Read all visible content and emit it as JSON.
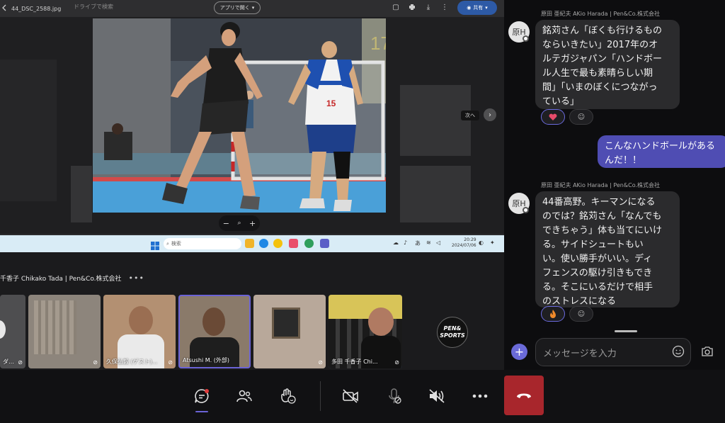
{
  "viewer": {
    "filename": "44_DSC_2588.jpg",
    "search_placeholder": "ドライブで検索",
    "open_with": "アプリで開く",
    "share": "共有",
    "next": "次へ"
  },
  "taskbar": {
    "search": "検索",
    "time": "20:29",
    "date": "2024/07/06",
    "ime": "あ"
  },
  "presenter": {
    "name": "千香子 Chikako Tada | Pen&Co.株式会社",
    "more": "•••"
  },
  "participants": [
    {
      "name": "ダ…",
      "muted": true
    },
    {
      "name": "",
      "muted": true
    },
    {
      "name": "久保弘毅 (ゲスト)...",
      "muted": true
    },
    {
      "name": "Atsushi M. (外部)",
      "muted": false
    },
    {
      "name": "",
      "muted": true
    },
    {
      "name": "多田 千香子 Chi...",
      "muted": true
    }
  ],
  "pen_logo": {
    "line1": "PEN&",
    "line2": "SPORTS"
  },
  "chat": {
    "messages": [
      {
        "sender": "原田 亜紀夫 AKio Harada | Pen&Co.株式会社",
        "avatar": "原H",
        "lines": [
          "銘苅さん「ぼくも行けるもの",
          "ならいきたい」2017年のオ",
          "ルテガジャパン「ハンドボー",
          "ル人生で最も素晴らしい期",
          "間」「いまのぼくにつながっ",
          "ている」"
        ],
        "reaction": "heart"
      },
      {
        "mine": true,
        "lines": [
          "こんなハンドボールがある",
          "んだ！！"
        ]
      },
      {
        "sender": "原田 亜紀夫 AKio Harada | Pen&Co.株式会社",
        "avatar": "原H",
        "lines": [
          "44番高野。キーマンになる",
          "のでは？銘苅さん「なんでも",
          "できちゃう」体も当てにいけ",
          "る。サイドシュートもい",
          "い。使い勝手がいい。ディ",
          "フェンスの駆け引きもでき",
          "る。そこにいるだけで相手",
          "のストレスになる"
        ],
        "reaction": "fire"
      }
    ],
    "input_placeholder": "メッセージを入力"
  },
  "controls": {
    "items": [
      "chat-icon",
      "people-icon",
      "raise-hand-icon",
      "camera-off-icon",
      "mic-off-icon",
      "speaker-off-icon",
      "more-icon",
      "leave-icon"
    ]
  },
  "colors": {
    "accent": "#6b63d6",
    "leave": "#a8262c",
    "my_bubble": "#4f4db3"
  }
}
